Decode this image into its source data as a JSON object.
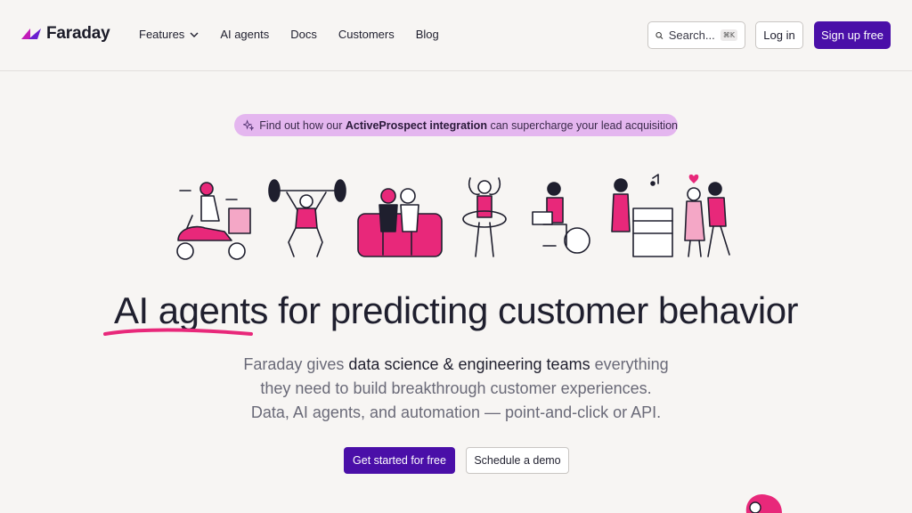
{
  "brand": {
    "name": "Faraday",
    "logo": "faraday-logo"
  },
  "nav": {
    "items": [
      {
        "label": "Features",
        "has_dropdown": true
      },
      {
        "label": "AI agents"
      },
      {
        "label": "Docs"
      },
      {
        "label": "Customers"
      },
      {
        "label": "Blog"
      }
    ],
    "search_label": "Search...",
    "search_shortcut": "⌘K",
    "login_label": "Log in",
    "signup_label": "Sign up free"
  },
  "banner": {
    "icon": "sparkle-icon",
    "text_before": "Find out how our ",
    "text_bold": "ActiveProspect integration",
    "text_after": " can supercharge your lead acquisition"
  },
  "hero": {
    "headline": "AI agents for predicting customer behavior",
    "sub_before": "Faraday gives ",
    "sub_bold": "data science & engineering teams",
    "sub_line1_after": " everything",
    "sub_line2": "they need to build breakthrough customer experiences.",
    "sub_line3": "Data, AI agents, and automation — point-and-click or API.",
    "cta_primary": "Get started for free",
    "cta_secondary": "Schedule a demo"
  },
  "colors": {
    "accent": "#4a0fa8",
    "pink": "#e8287a",
    "background": "#f7f5f3",
    "banner": "#e4b6ef"
  }
}
